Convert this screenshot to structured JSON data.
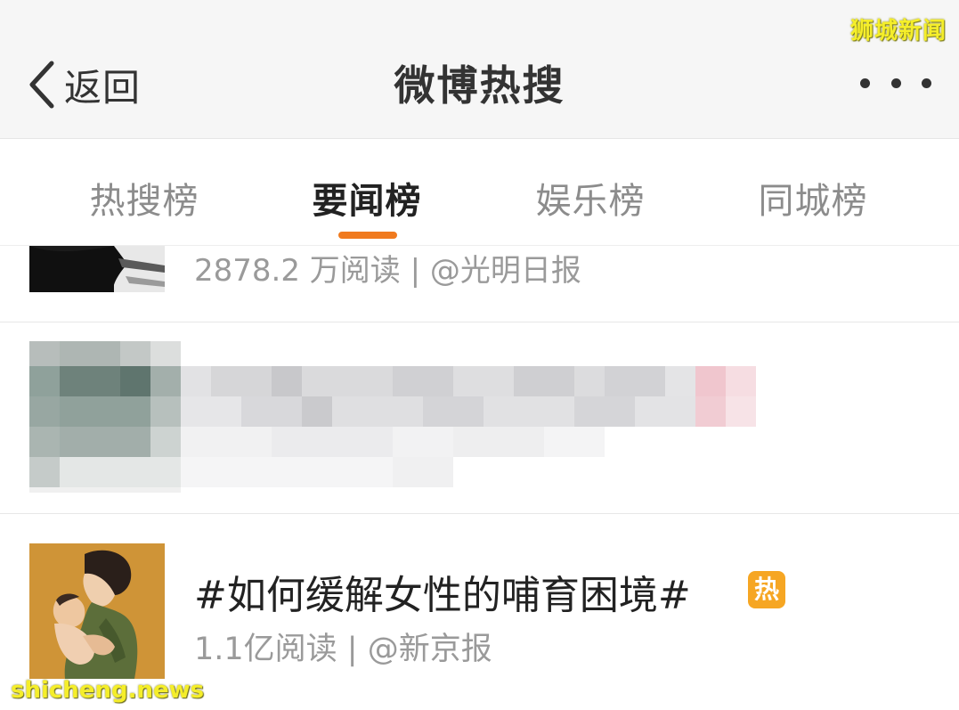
{
  "header": {
    "back_label": "返回",
    "title": "微博热搜",
    "more_icon": "more-dots-icon"
  },
  "watermark": {
    "top_right": "狮城新闻",
    "bottom_left": "shicheng.news",
    "color": "#f5ee2a"
  },
  "tabs": [
    {
      "label": "热搜榜",
      "active": false
    },
    {
      "label": "要闻榜",
      "active": true
    },
    {
      "label": "娱乐榜",
      "active": false
    },
    {
      "label": "同城榜",
      "active": false
    }
  ],
  "accent_color": "#f07a1e",
  "feed": {
    "items": [
      {
        "meta": "2878.2 万阅读 | @光明日报"
      },
      {
        "blurred": true
      },
      {
        "title": "#如何缓解女性的哺育困境#",
        "badge": "热",
        "badge_color": "#f6a623",
        "meta": "1.1亿阅读 | @新京报"
      }
    ]
  }
}
